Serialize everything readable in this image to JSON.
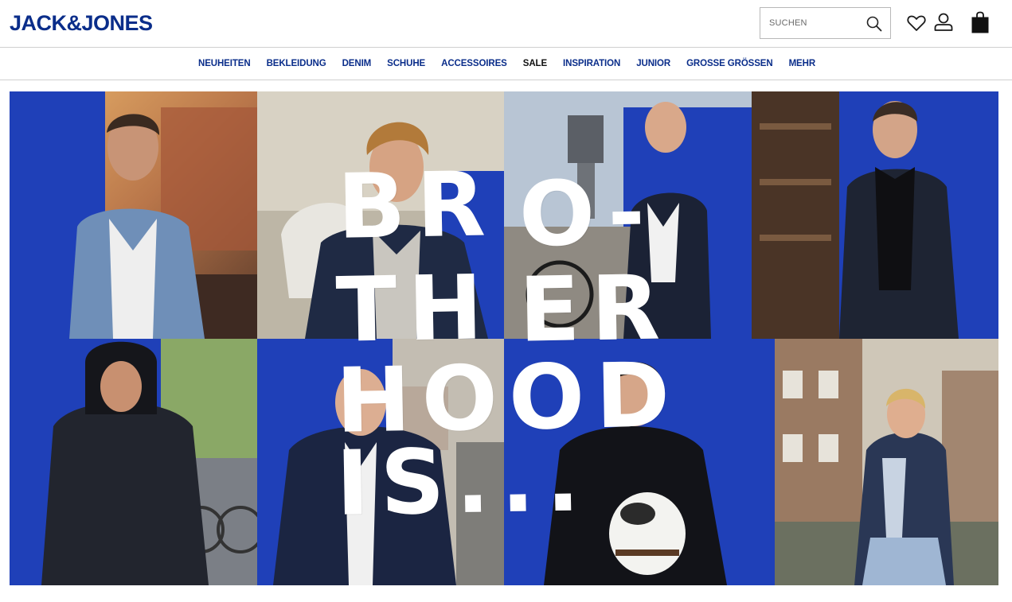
{
  "header": {
    "logo": "JACK&JONES",
    "search": {
      "placeholder": "SUCHEN"
    },
    "icons": [
      "search-icon",
      "heart-icon",
      "user-icon",
      "shopping-bag-icon"
    ]
  },
  "nav": {
    "items": [
      {
        "label": "NEUHEITEN"
      },
      {
        "label": "BEKLEIDUNG"
      },
      {
        "label": "DENIM"
      },
      {
        "label": "SCHUHE"
      },
      {
        "label": "ACCESSOIRES"
      },
      {
        "label": "SALE"
      },
      {
        "label": "INSPIRATION"
      },
      {
        "label": "JUNIOR"
      },
      {
        "label": "GROSSE GRÖSSEN"
      },
      {
        "label": "MEHR"
      }
    ]
  },
  "hero": {
    "lines": [
      "BR",
      "O-",
      "TH",
      "ER",
      "HOOD",
      "IS..."
    ]
  },
  "colors": {
    "brand": "#0a2d8a",
    "hero_blue": "#1d3fb8",
    "text_dark": "#111111"
  }
}
